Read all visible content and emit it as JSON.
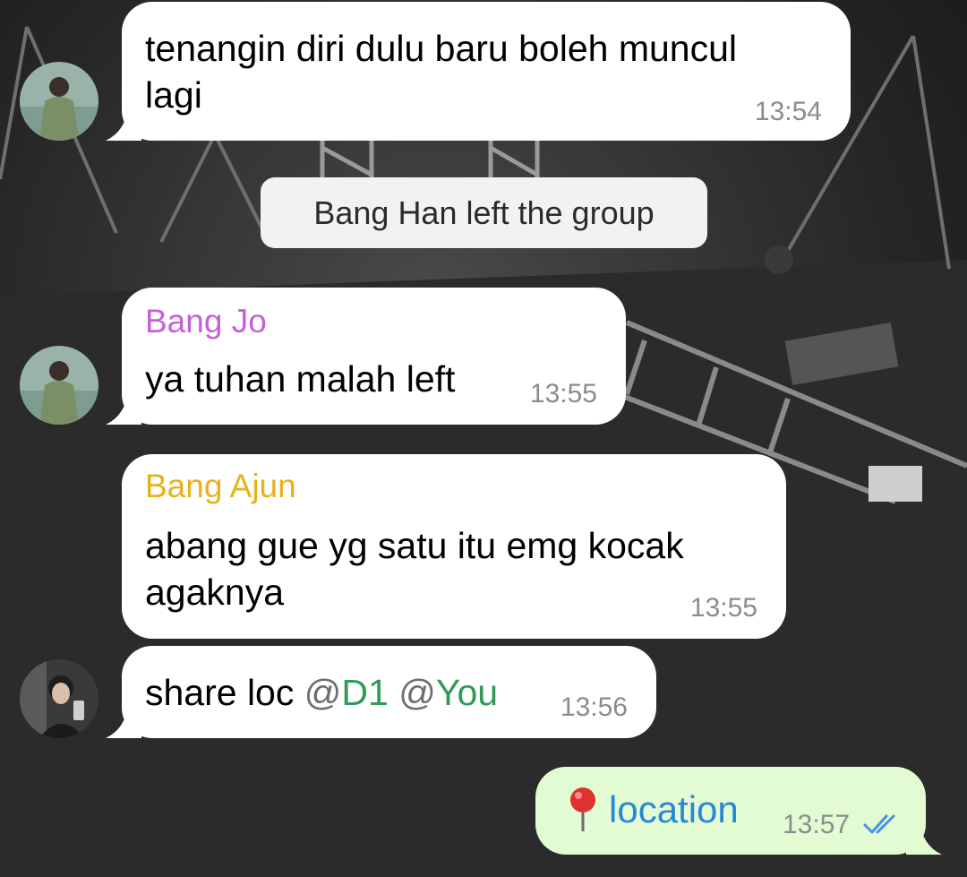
{
  "messages": [
    {
      "id": "m1",
      "text_line1": "tenangin diri dulu baru boleh muncul",
      "text_line2": "lagi",
      "time": "13:54"
    },
    {
      "id": "m2",
      "sender": "Bang Jo",
      "sender_color": "#c560d9",
      "text": "ya tuhan malah left",
      "time": "13:55"
    },
    {
      "id": "m3",
      "sender": "Bang Ajun",
      "sender_color": "#e7b21a",
      "text_line1": "abang gue yg satu itu emg kocak",
      "text_line2": "agaknya",
      "time": "13:55"
    },
    {
      "id": "m4",
      "text": "share loc",
      "mention_at": "@",
      "mention1": "D1",
      "mention2": "You",
      "time": "13:56"
    },
    {
      "id": "m5",
      "pin_icon": "map-pin-icon",
      "text": "location",
      "time": "13:57",
      "status_icon": "double-check-icon"
    }
  ],
  "system_message": "Bang Han left the group",
  "colors": {
    "bubble_in": "#ffffff",
    "bubble_out": "#e2fbd2",
    "time": "#8c8c8c",
    "mention": "#2f9a55",
    "location_link": "#2a86d8",
    "read_ticks": "#4a90e2"
  }
}
